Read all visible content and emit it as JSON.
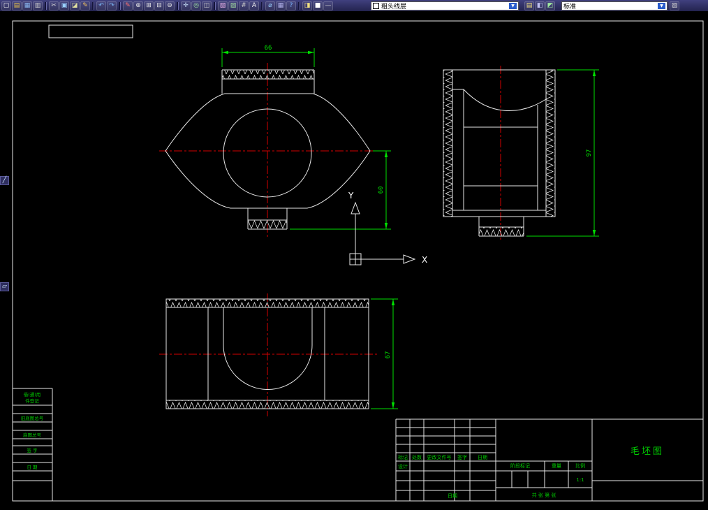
{
  "colors": {
    "background": "#000000",
    "line": "#e8e8e8",
    "center": "#d40000",
    "dim": "#00e000",
    "green": "#00cc00"
  },
  "toolbar": {
    "combo_arrow": "▼",
    "icons_left": [
      {
        "name": "new-icon",
        "glyph": "▢",
        "color": "#f2f2f2"
      },
      {
        "name": "open-icon",
        "glyph": "▤",
        "color": "#e8c34a"
      },
      {
        "name": "save-icon",
        "glyph": "▦",
        "color": "#8ab8f0"
      },
      {
        "name": "plot-icon",
        "glyph": "▥",
        "color": "#cfcfcf"
      },
      {
        "sep": true
      },
      {
        "name": "cut-icon",
        "glyph": "✂",
        "color": "#d8d8d8"
      },
      {
        "name": "copy-icon",
        "glyph": "▣",
        "color": "#9ad1ff"
      },
      {
        "name": "paste-icon",
        "glyph": "◪",
        "color": "#e0e0a0"
      },
      {
        "name": "match-properties-icon",
        "glyph": "✎",
        "color": "#f0c060"
      },
      {
        "sep": true
      },
      {
        "name": "undo-icon",
        "glyph": "↶",
        "color": "#79b4f2"
      },
      {
        "name": "redo-icon",
        "glyph": "↷",
        "color": "#79b4f2"
      },
      {
        "sep": true
      },
      {
        "name": "redraw-icon",
        "glyph": "✎",
        "color": "#ff7070"
      },
      {
        "name": "zoom-realtime-icon",
        "glyph": "⊕",
        "color": "#e8e8e8"
      },
      {
        "name": "zoom-window-icon",
        "glyph": "⊞",
        "color": "#e8e8e8"
      },
      {
        "name": "zoom-previous-icon",
        "glyph": "⊟",
        "color": "#e8e8e8"
      },
      {
        "name": "zoom-out-icon",
        "glyph": "⊖",
        "color": "#e8e8e8"
      },
      {
        "sep": true
      },
      {
        "name": "pan-icon",
        "glyph": "✛",
        "color": "#cfe8ff"
      },
      {
        "name": "orbit-icon",
        "glyph": "◎",
        "color": "#9fe89f"
      },
      {
        "name": "named-views-icon",
        "glyph": "◫",
        "color": "#d0d0d0"
      },
      {
        "sep": true
      },
      {
        "name": "block-icon",
        "glyph": "▧",
        "color": "#e8b0e8"
      },
      {
        "name": "hatch-icon",
        "glyph": "▨",
        "color": "#a0d8a0"
      },
      {
        "name": "table-icon",
        "glyph": "#",
        "color": "#c8c8c8"
      },
      {
        "name": "text-icon",
        "glyph": "A",
        "color": "#f0f0f0"
      },
      {
        "sep": true
      },
      {
        "name": "distance-icon",
        "glyph": "⌀",
        "color": "#9ad1ff"
      },
      {
        "name": "calculator-icon",
        "glyph": "▦",
        "color": "#b0b0e8"
      },
      {
        "name": "help-icon",
        "glyph": "?",
        "color": "#7ab4ff"
      },
      {
        "sep": true
      },
      {
        "name": "layer-states-icon",
        "glyph": "◨",
        "color": "#f0e080"
      },
      {
        "name": "color-control-icon",
        "glyph": "■",
        "color": "#ffffff"
      },
      {
        "name": "linetype-icon",
        "glyph": "—",
        "color": "#cfcfcf"
      }
    ],
    "layer_combo": {
      "value": "粗头线层"
    },
    "icons_mid": [
      {
        "name": "layer-properties-icon",
        "glyph": "▤",
        "color": "#f0e080"
      },
      {
        "name": "layer-previous-icon",
        "glyph": "◧",
        "color": "#c0c0f0"
      },
      {
        "name": "make-object-layer-icon",
        "glyph": "◩",
        "color": "#9fe89f"
      }
    ],
    "style_combo": {
      "value": "标准"
    },
    "icons_right": [
      {
        "name": "properties-panel-icon",
        "glyph": "▨",
        "color": "#d0d0d0"
      }
    ]
  },
  "side_buttons": [
    {
      "name": "draw-line-icon",
      "glyph": "╱"
    },
    {
      "name": "erase-icon",
      "glyph": "▱"
    }
  ],
  "drawing": {
    "ucs": {
      "x_label": "X",
      "y_label": "Y"
    },
    "views": {
      "front": {
        "dim_top": "66",
        "dim_right": "60"
      },
      "side": {
        "dim_right": "97"
      },
      "top": {
        "dim_right": "67"
      }
    }
  },
  "title_block": {
    "drawing_title": "毛坯图",
    "rev_headers": [
      "标记",
      "处数",
      "更改文件号",
      "签字",
      "日期"
    ],
    "designer_label": "设计",
    "date_label": "日期",
    "stage_label": "阶段标记",
    "weight_label": "重量",
    "scale_label": "比例",
    "scale_value": "1:1",
    "sheet_label": "共 张 第 张"
  },
  "side_block": {
    "row1a": "借(通)用",
    "row1b": "件登记",
    "row2": "旧底图总号",
    "row3": "底图总号",
    "row4": "签 字",
    "row5": "日 期"
  }
}
